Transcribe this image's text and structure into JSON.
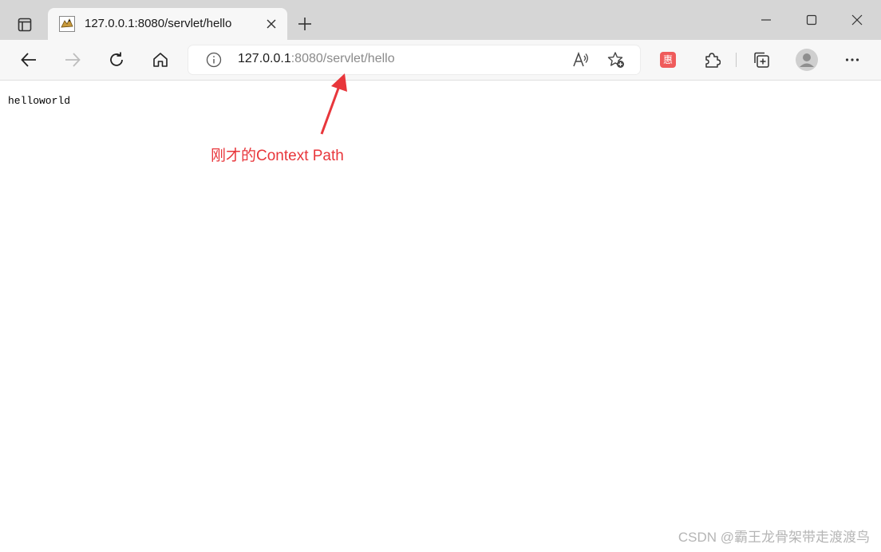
{
  "tab": {
    "title": "127.0.0.1:8080/servlet/hello"
  },
  "address_bar": {
    "host": "127.0.0.1",
    "path": ":8080/servlet/hello"
  },
  "page": {
    "body_text": "helloworld"
  },
  "annotation": {
    "text": "刚才的Context Path",
    "color": "#e8363b"
  },
  "watermark": "CSDN @霸王龙骨架带走渡渡鸟",
  "extension_badge": "惠",
  "colors": {
    "tabbar": "#d6d6d6",
    "toolbar": "#f7f7f7",
    "annotation": "#e8363b"
  }
}
